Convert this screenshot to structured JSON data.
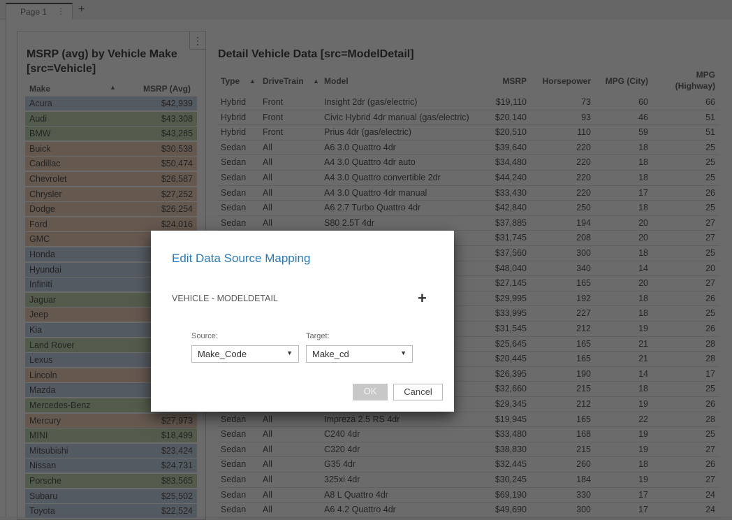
{
  "tabs": {
    "page1": "Page 1",
    "more": "⋮",
    "add": "+"
  },
  "left": {
    "title": "MSRP (avg) by Vehicle Make [src=Vehicle]",
    "menu": "⋮",
    "col_make": "Make",
    "col_msrp": "MSRP (Avg)",
    "sort": "▲",
    "rows": [
      [
        "Acura",
        "$42,939",
        "b"
      ],
      [
        "Audi",
        "$43,308",
        "g"
      ],
      [
        "BMW",
        "$43,285",
        "g"
      ],
      [
        "Buick",
        "$30,538",
        "o"
      ],
      [
        "Cadillac",
        "$50,474",
        "o"
      ],
      [
        "Chevrolet",
        "$26,587",
        "o"
      ],
      [
        "Chrysler",
        "$27,252",
        "o"
      ],
      [
        "Dodge",
        "$26,254",
        "o"
      ],
      [
        "Ford",
        "$24,016",
        "o"
      ],
      [
        "GMC",
        "",
        "o"
      ],
      [
        "Honda",
        "",
        "b"
      ],
      [
        "Hyundai",
        "",
        "b"
      ],
      [
        "Infiniti",
        "",
        "b"
      ],
      [
        "Jaguar",
        "",
        "g"
      ],
      [
        "Jeep",
        "",
        "o"
      ],
      [
        "Kia",
        "",
        "b"
      ],
      [
        "Land Rover",
        "",
        "g"
      ],
      [
        "Lexus",
        "",
        "b"
      ],
      [
        "Lincoln",
        "",
        "o"
      ],
      [
        "Mazda",
        "",
        "b"
      ],
      [
        "Mercedes-Benz",
        "",
        "g"
      ],
      [
        "Mercury",
        "$27,973",
        "o"
      ],
      [
        "MINI",
        "$18,499",
        "g"
      ],
      [
        "Mitsubishi",
        "$23,424",
        "b"
      ],
      [
        "Nissan",
        "$24,731",
        "b"
      ],
      [
        "Porsche",
        "$83,565",
        "g"
      ],
      [
        "Subaru",
        "$25,502",
        "b"
      ],
      [
        "Toyota",
        "$22,524",
        "b"
      ]
    ]
  },
  "colors": {
    "b": "#c9d6e8",
    "g": "#c6dcb4",
    "o": "#f0d2bc",
    "accent": "#2a7ab8"
  },
  "right": {
    "title": "Detail Vehicle Data [src=ModelDetail]",
    "headers": [
      "Type",
      "DriveTrain",
      "Model",
      "MSRP",
      "Horsepower",
      "MPG (City)",
      "MPG (Highway)"
    ],
    "sort": "▲",
    "rows": [
      [
        "Hybrid",
        "Front",
        "Insight 2dr (gas/electric)",
        "$19,110",
        "73",
        "60",
        "66"
      ],
      [
        "Hybrid",
        "Front",
        "Civic Hybrid 4dr manual (gas/electric)",
        "$20,140",
        "93",
        "46",
        "51"
      ],
      [
        "Hybrid",
        "Front",
        "Prius 4dr (gas/electric)",
        "$20,510",
        "110",
        "59",
        "51"
      ],
      [
        "Sedan",
        "All",
        "A6 3.0 Quattro 4dr",
        "$39,640",
        "220",
        "18",
        "25"
      ],
      [
        "Sedan",
        "All",
        "A4 3.0 Quattro 4dr auto",
        "$34,480",
        "220",
        "18",
        "25"
      ],
      [
        "Sedan",
        "All",
        "A4 3.0 Quattro convertible 2dr",
        "$44,240",
        "220",
        "18",
        "25"
      ],
      [
        "Sedan",
        "All",
        "A4 3.0 Quattro 4dr manual",
        "$33,430",
        "220",
        "17",
        "26"
      ],
      [
        "Sedan",
        "All",
        "A6 2.7 Turbo Quattro 4dr",
        "$42,840",
        "250",
        "18",
        "25"
      ],
      [
        "Sedan",
        "All",
        "S80 2.5T 4dr",
        "$37,885",
        "194",
        "20",
        "27"
      ],
      [
        "",
        "",
        "",
        "$31,745",
        "208",
        "20",
        "27"
      ],
      [
        "",
        "",
        "",
        "$37,560",
        "300",
        "18",
        "25"
      ],
      [
        "",
        "",
        "",
        "$48,040",
        "340",
        "14",
        "20"
      ],
      [
        "",
        "",
        "",
        "$27,145",
        "165",
        "20",
        "27"
      ],
      [
        "",
        "",
        "",
        "$29,995",
        "192",
        "18",
        "26"
      ],
      [
        "",
        "",
        "",
        "$33,995",
        "227",
        "18",
        "25"
      ],
      [
        "",
        "",
        "",
        "$31,545",
        "212",
        "19",
        "26"
      ],
      [
        "",
        "",
        "",
        "$25,645",
        "165",
        "21",
        "28"
      ],
      [
        "",
        "",
        "",
        "$20,445",
        "165",
        "21",
        "28"
      ],
      [
        "",
        "",
        "",
        "$26,395",
        "190",
        "14",
        "17"
      ],
      [
        "",
        "",
        "",
        "$32,660",
        "215",
        "18",
        "25"
      ],
      [
        "",
        "",
        "",
        "$29,345",
        "212",
        "19",
        "26"
      ],
      [
        "Sedan",
        "All",
        "Impreza 2.5 RS 4dr",
        "$19,945",
        "165",
        "22",
        "28"
      ],
      [
        "Sedan",
        "All",
        "C240 4dr",
        "$33,480",
        "168",
        "19",
        "25"
      ],
      [
        "Sedan",
        "All",
        "C320 4dr",
        "$38,830",
        "215",
        "19",
        "27"
      ],
      [
        "Sedan",
        "All",
        "G35 4dr",
        "$32,445",
        "260",
        "18",
        "26"
      ],
      [
        "Sedan",
        "All",
        "325xi 4dr",
        "$30,245",
        "184",
        "19",
        "27"
      ],
      [
        "Sedan",
        "All",
        "A8 L Quattro 4dr",
        "$69,190",
        "330",
        "17",
        "24"
      ],
      [
        "Sedan",
        "All",
        "A6 4.2 Quattro 4dr",
        "$49,690",
        "300",
        "17",
        "24"
      ]
    ]
  },
  "dialog": {
    "title": "Edit Data Source Mapping",
    "section": "VEHICLE - MODELDETAIL",
    "add": "+",
    "source_label": "Source:",
    "source_value": "Make_Code",
    "target_label": "Target:",
    "target_value": "Make_cd",
    "arrow": "▼",
    "ok": "OK",
    "cancel": "Cancel"
  }
}
